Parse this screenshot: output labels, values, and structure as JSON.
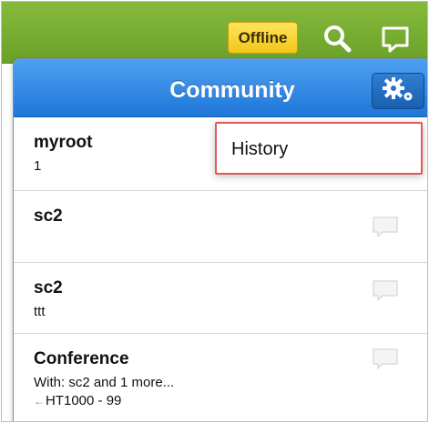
{
  "topbar": {
    "status_badge": "Offline",
    "icons": [
      "search-icon",
      "chat-icon"
    ]
  },
  "panel": {
    "title": "Community",
    "settings_icon": "gear-icon"
  },
  "menu": {
    "items": [
      {
        "label": "History"
      }
    ]
  },
  "conversations": [
    {
      "name": "myroot",
      "line1": "1",
      "line2": ""
    },
    {
      "name": "sc2",
      "line1": "",
      "line2": ""
    },
    {
      "name": "sc2",
      "line1": "ttt",
      "line2": ""
    },
    {
      "name": "Conference",
      "line1": "With: sc2 and 1 more...",
      "line2": "HT1000 - 99"
    }
  ],
  "colors": {
    "topbar": "#79ae33",
    "badge": "#f7d52e",
    "header": "#2f86e2",
    "menu_border": "#e05a5a"
  }
}
